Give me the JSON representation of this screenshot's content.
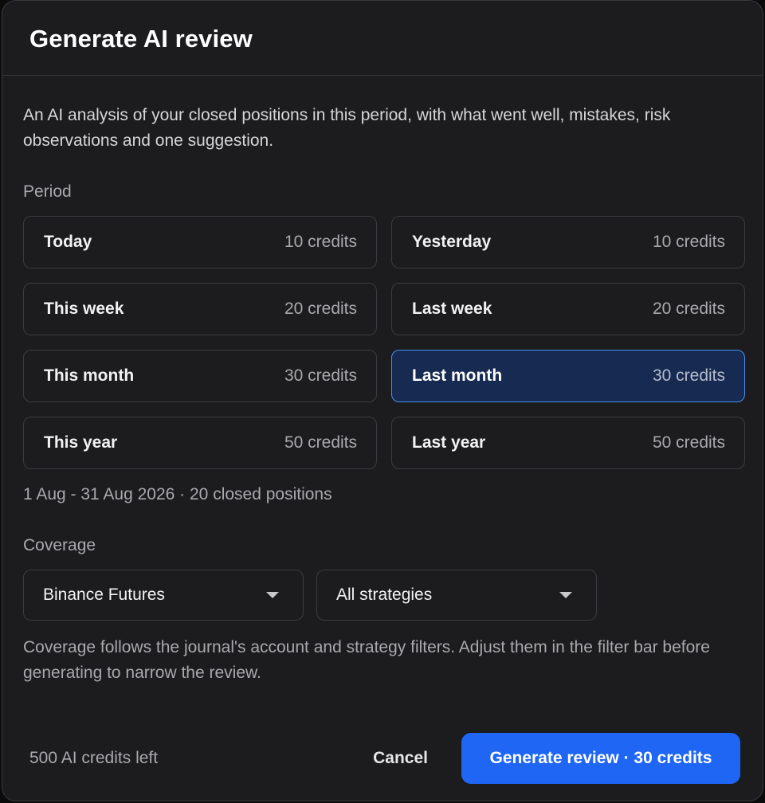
{
  "dialog": {
    "title": "Generate AI review",
    "description": "An AI analysis of your closed positions in this period, with what went well, mistakes, risk observations and one suggestion."
  },
  "period": {
    "label": "Period",
    "options": [
      {
        "name": "Today",
        "cost": "10 credits",
        "selected": false
      },
      {
        "name": "Yesterday",
        "cost": "10 credits",
        "selected": false
      },
      {
        "name": "This week",
        "cost": "20 credits",
        "selected": false
      },
      {
        "name": "Last week",
        "cost": "20 credits",
        "selected": false
      },
      {
        "name": "This month",
        "cost": "30 credits",
        "selected": false
      },
      {
        "name": "Last month",
        "cost": "30 credits",
        "selected": true
      },
      {
        "name": "This year",
        "cost": "50 credits",
        "selected": false
      },
      {
        "name": "Last year",
        "cost": "50 credits",
        "selected": false
      }
    ],
    "range_summary": "1 Aug - 31 Aug 2026 · 20 closed positions"
  },
  "coverage": {
    "label": "Coverage",
    "account_select": "Binance Futures",
    "strategy_select": "All strategies",
    "note": "Coverage follows the journal's account and strategy filters. Adjust them in the filter bar before generating to narrow the review."
  },
  "footer": {
    "credits_left": "500 AI credits left",
    "cancel_label": "Cancel",
    "generate_label": "Generate review · 30 credits"
  },
  "colors": {
    "accent": "#1f66f5",
    "selected_bg": "#172a51",
    "selected_border": "#4a8ef0",
    "surface": "#1c1c1e"
  }
}
